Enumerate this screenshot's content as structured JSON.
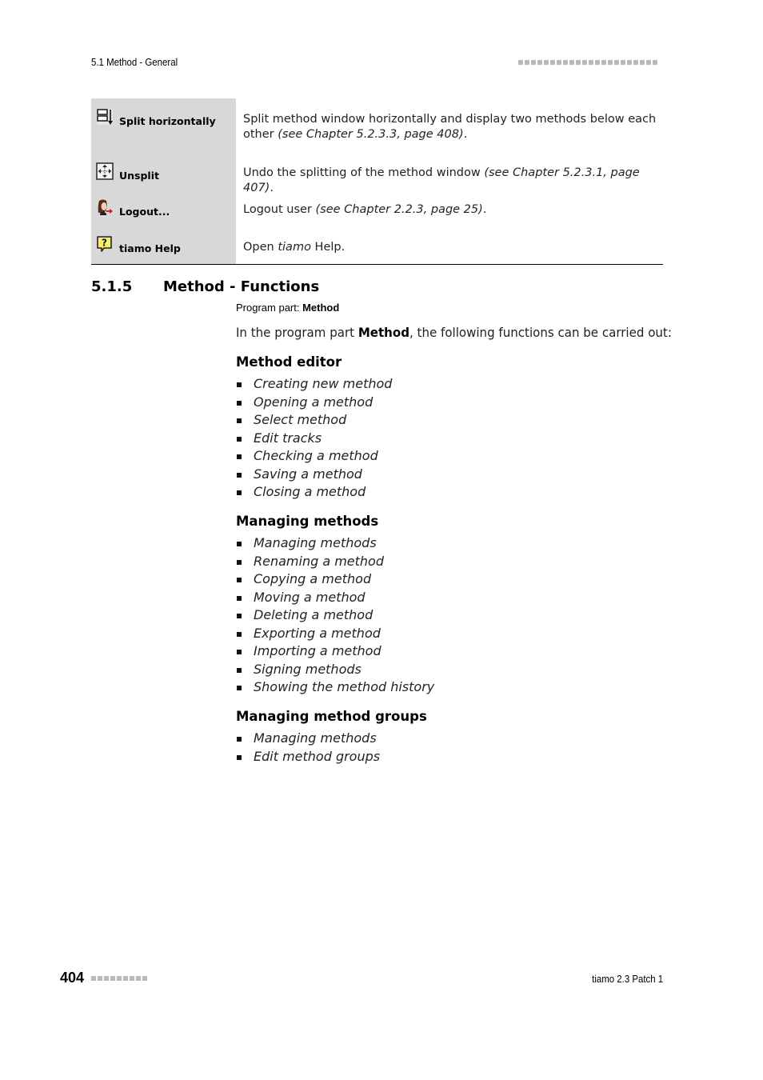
{
  "header": {
    "section_title": "5.1 Method - General",
    "decoration_squares": 22
  },
  "table": {
    "rows": [
      {
        "icon": "split-horizontally-icon",
        "label": "Split horizontally",
        "description": "Split method window horizontally and display two methods below each other ",
        "reference": "(see Chapter 5.2.3.3, page 408)",
        "suffix": "."
      },
      {
        "icon": "unsplit-icon",
        "label": "Unsplit",
        "description": "Undo the splitting of the method window ",
        "reference": "(see Chapter 5.2.3.1, page 407)",
        "suffix": "."
      },
      {
        "icon": "logout-icon",
        "label": "Logout...",
        "description": "Logout user ",
        "reference": "(see Chapter 2.2.3, page 25)",
        "suffix": "."
      },
      {
        "icon": "help-icon",
        "label": "tiamo Help",
        "description": "Open ",
        "reference": "tiamo",
        "suffix": " Help."
      }
    ]
  },
  "section": {
    "number": "5.1.5",
    "title": "Method - Functions",
    "program_part_label": "Program part: ",
    "program_part_value": "Method",
    "intro_prefix": "In the program part ",
    "intro_bold": "Method",
    "intro_suffix": ", the following functions can be carried out:",
    "groups": [
      {
        "heading": "Method editor",
        "items": [
          "Creating new method",
          "Opening a method",
          "Select method",
          "Edit tracks",
          "Checking a method",
          "Saving a method",
          "Closing a method"
        ]
      },
      {
        "heading": "Managing methods",
        "items": [
          "Managing methods",
          "Renaming a method",
          "Copying a method",
          "Moving a method",
          "Deleting a method",
          "Exporting a method",
          "Importing a method",
          "Signing methods",
          "Showing the method history"
        ]
      },
      {
        "heading": "Managing method groups",
        "items": [
          "Managing methods",
          "Edit method groups"
        ]
      }
    ]
  },
  "footer": {
    "page_number": "404",
    "decoration_squares": 9,
    "product": "tiamo 2.3 Patch 1"
  },
  "colors": {
    "table_label_bg": "#d8d8d8",
    "decoration_square": "#b9b9b9"
  }
}
